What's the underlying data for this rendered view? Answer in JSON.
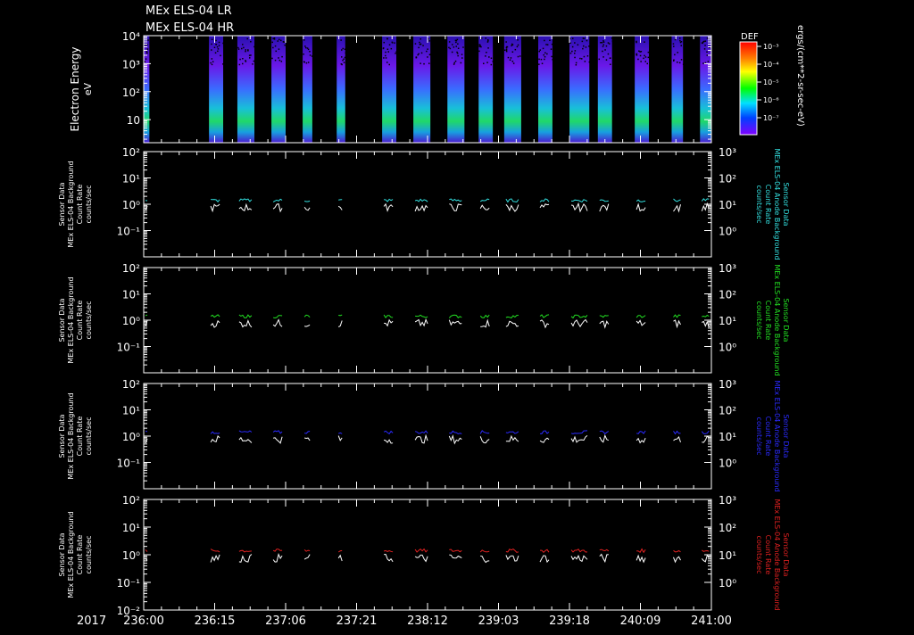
{
  "title": {
    "line1": "MEx ELS-04 LR",
    "line2": "MEx ELS-04 HR"
  },
  "colorbar": {
    "label": "DEF",
    "units": "ergs/(cm**2-sr-sec-eV)",
    "ticks": [
      "10⁻³",
      "10⁻⁴",
      "10⁻⁵",
      "10⁻⁶",
      "10⁻⁷"
    ]
  },
  "colors": {
    "panel2": "#33e0e0",
    "panel3": "#22e022",
    "panel4": "#2a2aff",
    "panel5": "#e02020",
    "white": "#ffffff"
  },
  "x_axis": {
    "year": "2017",
    "ticks": [
      "236:00",
      "236:15",
      "237:06",
      "237:21",
      "238:12",
      "239:03",
      "239:18",
      "240:09",
      "241:00"
    ]
  },
  "chart_data": [
    {
      "type": "heatmap",
      "ylabel": "Electron Energy",
      "yunit": "eV",
      "ylim": [
        1.5,
        10000
      ],
      "yscale": "log",
      "yticks": [
        "10⁴",
        "10³",
        "10²",
        "10"
      ],
      "data_intervals": [
        [
          0.0,
          0.01
        ],
        [
          0.115,
          0.14
        ],
        [
          0.165,
          0.195
        ],
        [
          0.225,
          0.25
        ],
        [
          0.28,
          0.297
        ],
        [
          0.34,
          0.355
        ],
        [
          0.42,
          0.445
        ],
        [
          0.475,
          0.505
        ],
        [
          0.535,
          0.565
        ],
        [
          0.59,
          0.615
        ],
        [
          0.635,
          0.665
        ],
        [
          0.695,
          0.72
        ],
        [
          0.75,
          0.785
        ],
        [
          0.8,
          0.825
        ],
        [
          0.865,
          0.89
        ],
        [
          0.93,
          0.95
        ],
        [
          0.98,
          1.0
        ]
      ]
    },
    {
      "type": "line",
      "ylabel_left": [
        "Sensor Data",
        "MEx ELS-04 Background",
        "Count Rate",
        "counts/sec"
      ],
      "ylabel_right": [
        "Sensor Data",
        "MEx ELS-04 Anode Background",
        "Count Rate",
        "counts/sec"
      ],
      "ylim_left": [
        0.01,
        100
      ],
      "ylim_right": [
        0.1,
        1000
      ],
      "yscale": "log",
      "yticks_left": [
        "10²",
        "10¹",
        "10⁰",
        "10⁻¹"
      ],
      "yticks_right": [
        "10³",
        "10²",
        "10¹",
        "10⁰"
      ],
      "series": [
        {
          "color": "#33e0e0",
          "level": 1.4
        },
        {
          "color": "#ffffff",
          "level": 0.75
        }
      ]
    },
    {
      "type": "line",
      "ylabel_left": [
        "Sensor Data",
        "MEx ELS-04 Background",
        "Count Rate",
        "counts/sec"
      ],
      "ylabel_right": [
        "Sensor Data",
        "MEx ELS-04 Anode Background",
        "Count Rate",
        "counts/sec"
      ],
      "ylim_left": [
        0.01,
        100
      ],
      "ylim_right": [
        0.1,
        1000
      ],
      "yscale": "log",
      "yticks_left": [
        "10²",
        "10¹",
        "10⁰",
        "10⁻¹"
      ],
      "yticks_right": [
        "10³",
        "10²",
        "10¹",
        "10⁰"
      ],
      "series": [
        {
          "color": "#22e022",
          "level": 1.4
        },
        {
          "color": "#ffffff",
          "level": 0.75
        }
      ]
    },
    {
      "type": "line",
      "ylabel_left": [
        "Sensor Data",
        "MEx ELS-04 Background",
        "Count Rate",
        "counts/sec"
      ],
      "ylabel_right": [
        "Sensor Data",
        "MEx ELS-04 Anode Background",
        "Count Rate",
        "counts/sec"
      ],
      "ylim_left": [
        0.01,
        100
      ],
      "ylim_right": [
        0.1,
        1000
      ],
      "yscale": "log",
      "yticks_left": [
        "10²",
        "10¹",
        "10⁰",
        "10⁻¹"
      ],
      "yticks_right": [
        "10³",
        "10²",
        "10¹",
        "10⁰"
      ],
      "series": [
        {
          "color": "#2a2aff",
          "level": 1.4
        },
        {
          "color": "#ffffff",
          "level": 0.75
        }
      ]
    },
    {
      "type": "line",
      "ylabel_left": [
        "Sensor Data",
        "MEx ELS-04 Background",
        "Count Rate",
        "counts/sec"
      ],
      "ylabel_right": [
        "Sensor Data",
        "MEx ELS-04 Anode Background",
        "Count Rate",
        "counts/sec"
      ],
      "ylim_left": [
        0.01,
        100
      ],
      "ylim_right": [
        0.1,
        1000
      ],
      "yscale": "log",
      "yticks_left": [
        "10²",
        "10¹",
        "10⁰",
        "10⁻¹",
        "10⁻²"
      ],
      "yticks_right": [
        "10³",
        "10²",
        "10¹",
        "10⁰"
      ],
      "series": [
        {
          "color": "#e02020",
          "level": 1.4
        },
        {
          "color": "#ffffff",
          "level": 0.75
        }
      ]
    }
  ]
}
